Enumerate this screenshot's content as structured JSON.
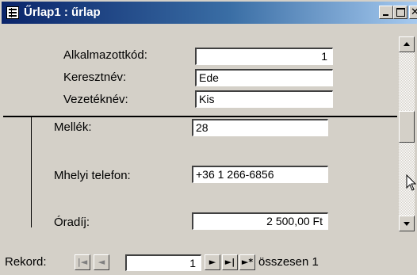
{
  "window": {
    "title": "Űrlap1 : űrlap"
  },
  "header_fields": [
    {
      "label": "Alkalmazottkód:",
      "value": "1"
    },
    {
      "label": "Keresztnév:",
      "value": "Ede"
    },
    {
      "label": "Vezetéknév:",
      "value": "Kis"
    }
  ],
  "detail_fields": [
    {
      "label": "Mellék:",
      "value": "28"
    },
    {
      "label": "Mhelyi telefon:",
      "value": "+36 1 266-6856"
    },
    {
      "label": "Óradíj:",
      "value": "2 500,00 Ft"
    }
  ],
  "navigation": {
    "label": "Rekord:",
    "current_record": "1",
    "total_text": "összesen 1",
    "first_symbol": "|◄",
    "prev_symbol": "◄",
    "next_symbol": "►",
    "last_symbol": "►|",
    "new_symbol": "►*"
  },
  "colors": {
    "titlebar_start": "#0a246a",
    "titlebar_end": "#a6caf0",
    "face": "#d4d0c8"
  }
}
